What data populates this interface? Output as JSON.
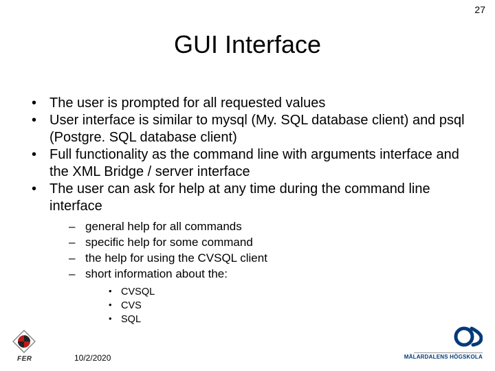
{
  "page_number": "27",
  "title": "GUI Interface",
  "bullets": [
    "The user is prompted for all requested values",
    "User interface is similar to mysql (My. SQL database client) and psql (Postgre. SQL database client)",
    "Full functionality as the command line with arguments interface and the XML Bridge / server interface",
    "The user can ask for help at any time during the command line interface"
  ],
  "sub_bullets": [
    "general help for all commands",
    "specific help for some command",
    "the help for using the CVSQL client",
    "short information about the:"
  ],
  "sub_sub_bullets": [
    "CVSQL",
    "CVS",
    "SQL"
  ],
  "footer": {
    "date": "10/2/2020",
    "left_logo_label": "FER",
    "right_logo_label": "MÄLARDALENS HÖGSKOLA"
  }
}
